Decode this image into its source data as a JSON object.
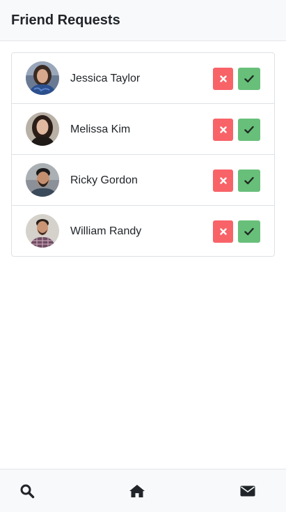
{
  "header": {
    "title": "Friend Requests"
  },
  "requests": [
    {
      "name": "Jessica Taylor",
      "avatar": "avatar-photo"
    },
    {
      "name": "Melissa Kim",
      "avatar": "avatar-photo"
    },
    {
      "name": "Ricky Gordon",
      "avatar": "avatar-photo"
    },
    {
      "name": "William Randy",
      "avatar": "avatar-photo"
    }
  ],
  "actions": {
    "decline_icon": "times-icon",
    "accept_icon": "check-icon"
  },
  "nav": [
    {
      "icon": "search-icon"
    },
    {
      "icon": "home-icon"
    },
    {
      "icon": "envelope-icon"
    }
  ],
  "colors": {
    "decline": "#f86368",
    "accept": "#68bf7a",
    "header_bg": "#f8f9fa",
    "text": "#212529"
  }
}
